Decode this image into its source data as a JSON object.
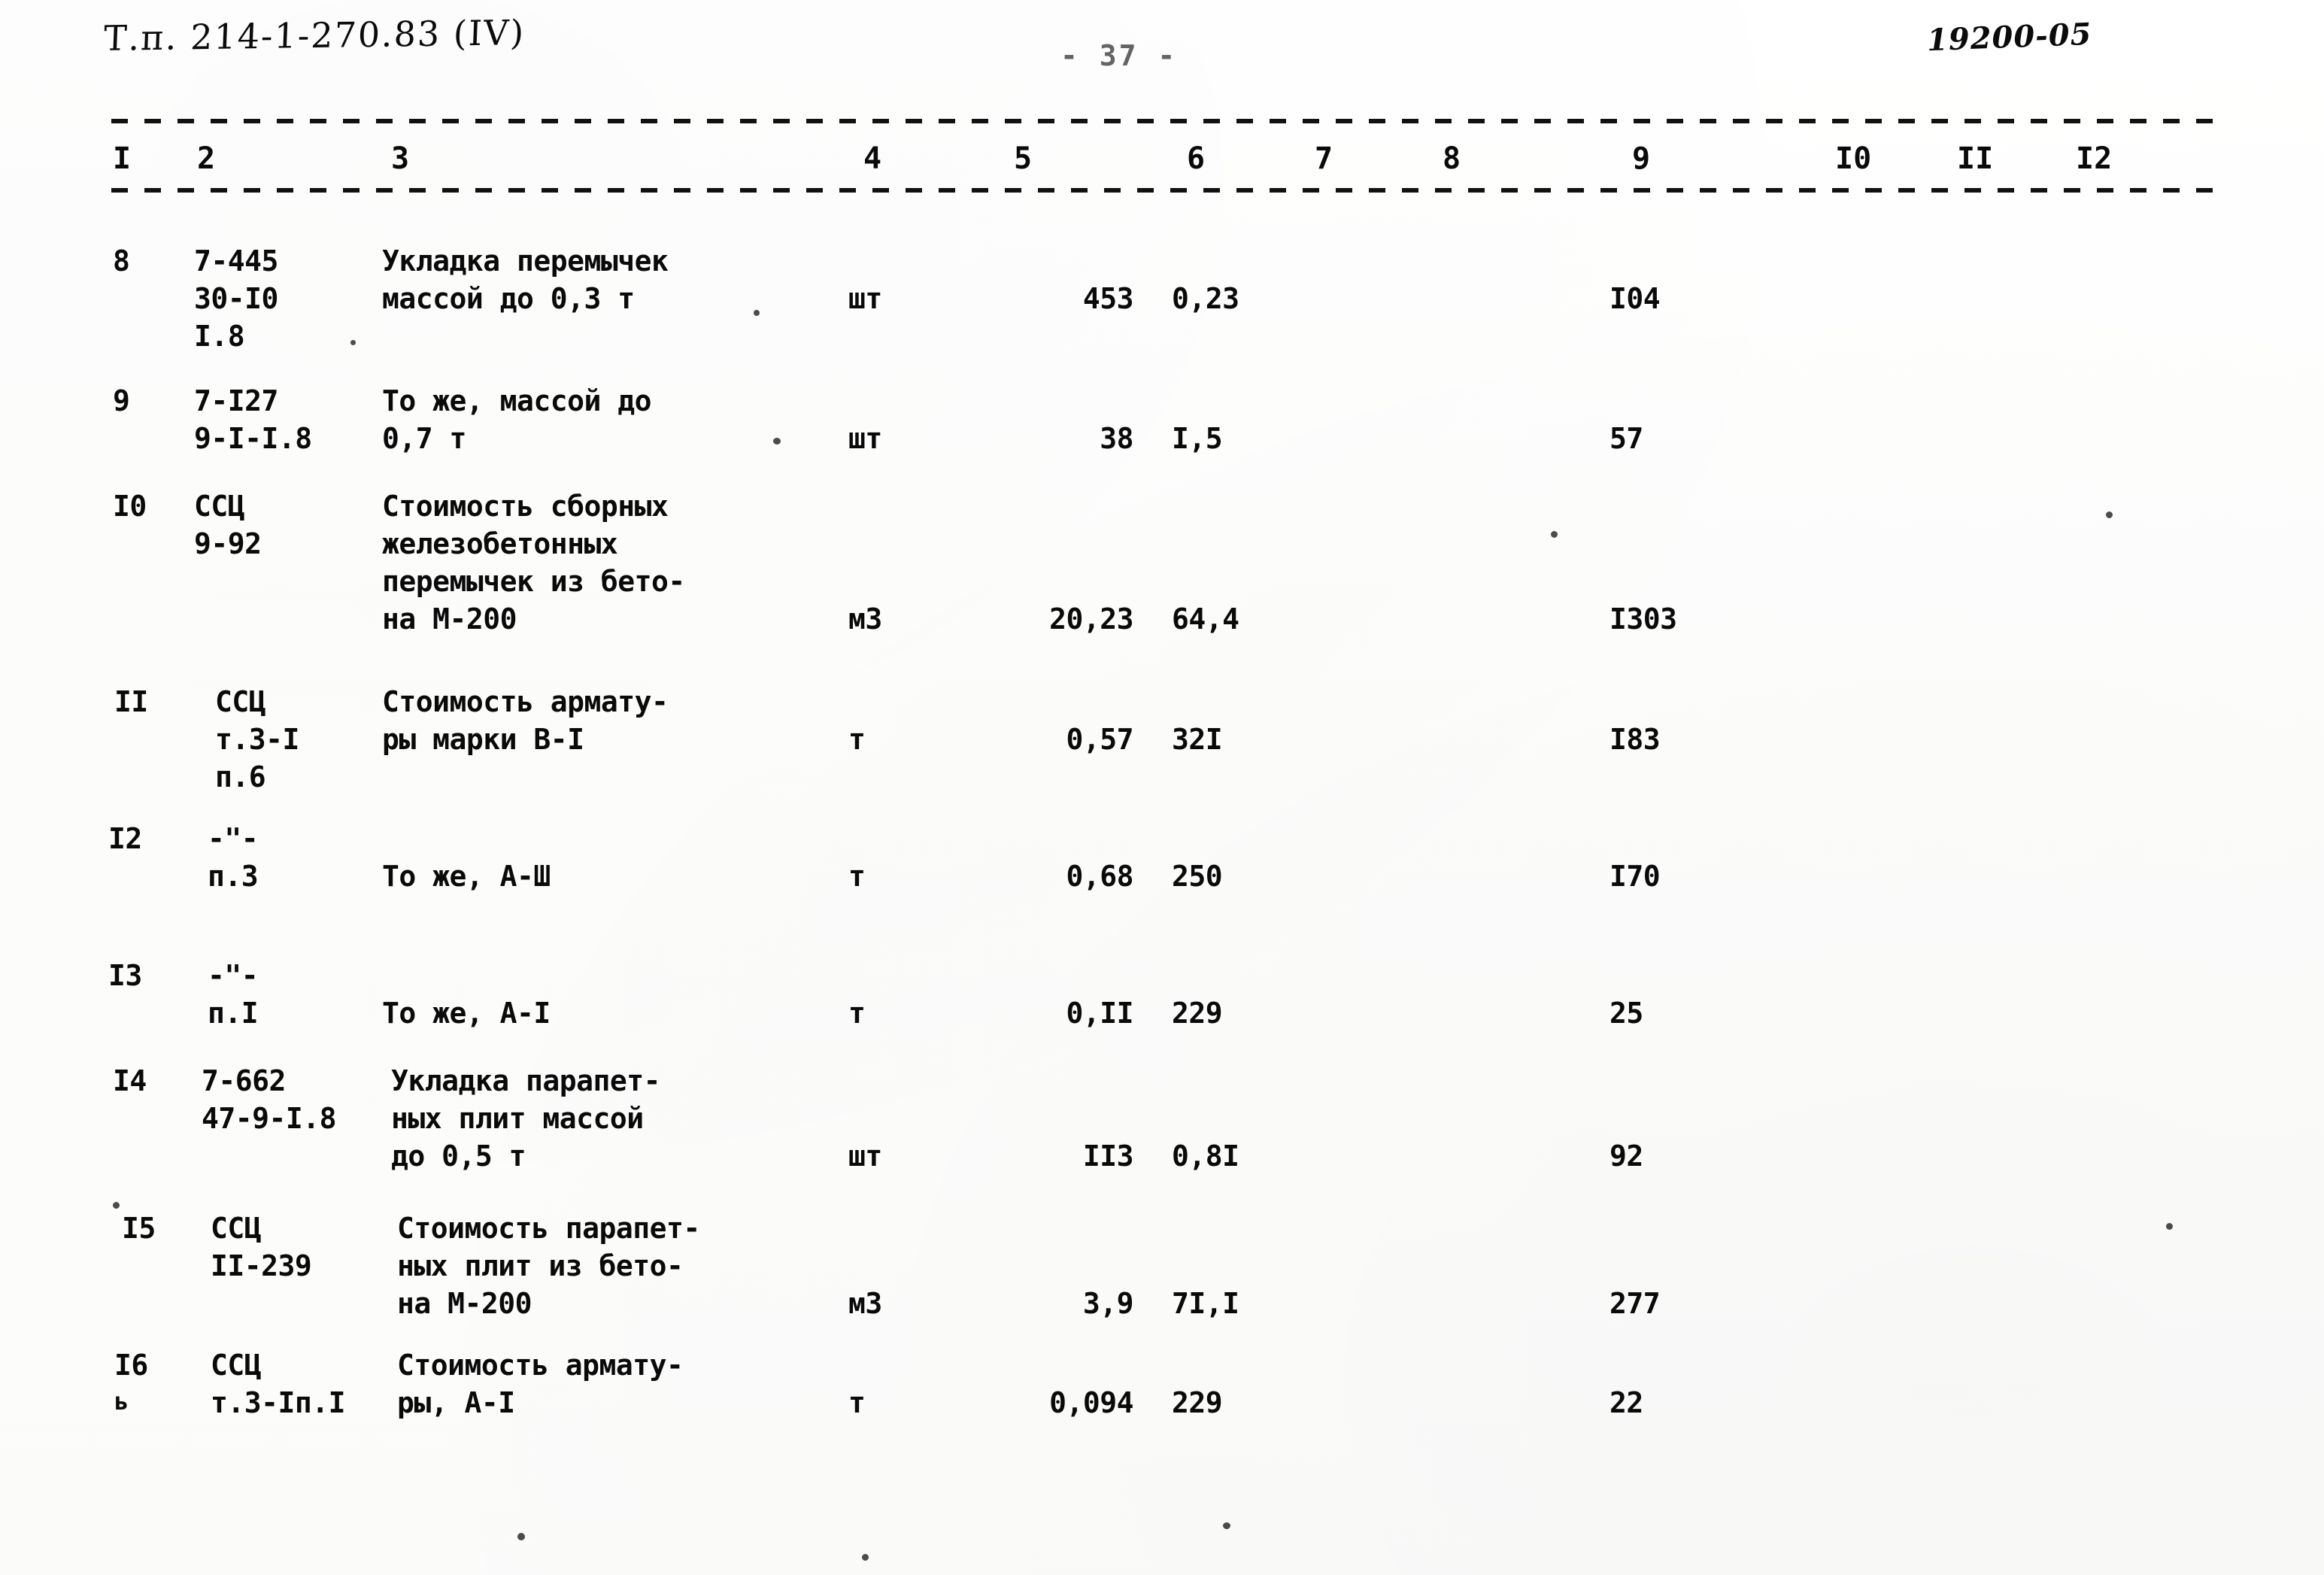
{
  "header": {
    "doc_code": "Т.п. 214-1-270.83 (IV)",
    "page_number": "- 37 -",
    "sheet_code": "19200-05"
  },
  "table": {
    "column_headers": [
      "I",
      "2",
      "3",
      "4",
      "5",
      "6",
      "7",
      "8",
      "9",
      "I0",
      "II",
      "I2"
    ],
    "rows": [
      {
        "num": "8",
        "code": "7-445\n30-I0\nI.8",
        "desc": "Укладка перемычек\nмассой до 0,3 т",
        "unit": "шт",
        "qty": "453",
        "price": "0,23",
        "total": "I04"
      },
      {
        "num": "9",
        "code": "7-I27\n9-I-I.8",
        "desc": "То же, массой до\n0,7 т",
        "unit": "шт",
        "qty": "38",
        "price": "I,5",
        "total": "57"
      },
      {
        "num": "I0",
        "code": "ССЦ\n9-92",
        "desc": "Стоимость сборных\nжелезобетонных\nперемычек из бето-\nна М-200",
        "unit": "м3",
        "qty": "20,23",
        "price": "64,4",
        "total": "I303"
      },
      {
        "num": "II",
        "code": "ССЦ\nт.3-I\nп.6",
        "desc": "Стоимость армату-\nры марки В-I",
        "unit": "т",
        "qty": "0,57",
        "price": "32I",
        "total": "I83"
      },
      {
        "num": "I2",
        "code": "-\"-\nп.3",
        "desc": "То же, А-Ш",
        "unit": "т",
        "qty": "0,68",
        "price": "250",
        "total": "I70"
      },
      {
        "num": "I3",
        "code": "-\"-\nп.I",
        "desc": "То же, А-I",
        "unit": "т",
        "qty": "0,II",
        "price": "229",
        "total": "25"
      },
      {
        "num": "I4",
        "code": "7-662\n47-9-I.8",
        "desc": "Укладка парапет-\nных плит массой\nдо 0,5 т",
        "unit": "шт",
        "qty": "II3",
        "price": "0,8I",
        "total": "92"
      },
      {
        "num": "I5",
        "code": "ССЦ\nII-239",
        "desc": "Стоимость парапет-\nных плит из бето-\nна М-200",
        "unit": "м3",
        "qty": "3,9",
        "price": "7I,I",
        "total": "277"
      },
      {
        "num": "I6",
        "code": "ССЦ\nт.3-Iп.I",
        "desc": "Стоимость армату-\nры, А-I",
        "unit": "т",
        "qty": "0,094",
        "price": "229",
        "total": "22"
      }
    ],
    "stray_mark": "ь"
  }
}
